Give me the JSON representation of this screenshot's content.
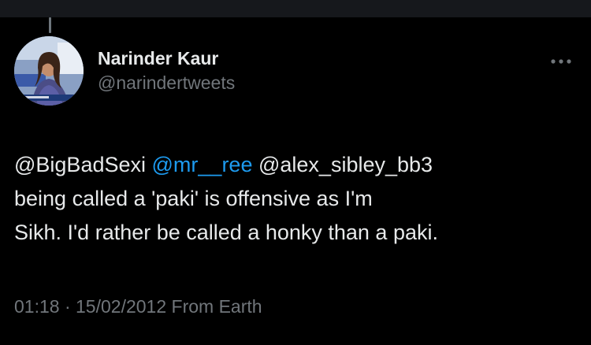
{
  "author": {
    "display_name": "Narinder Kaur",
    "handle": "@narindertweets"
  },
  "icons": {
    "more": "more-horizontal-icon",
    "avatar": "profile-photo"
  },
  "tweet": {
    "mentions": [
      "@BigBadSexi",
      "@mr__ree",
      "@alex_sibley_bb3"
    ],
    "line2": "being called a 'paki' is offensive as I'm",
    "line3": "Sikh. I'd rather be called a honky than a paki."
  },
  "meta": {
    "time": "01:18",
    "separator": "·",
    "date": "15/02/2012",
    "source": "From Earth"
  },
  "colors": {
    "background": "#000000",
    "text": "#e7e9ea",
    "secondary": "#71767b",
    "link": "#1d9bf0"
  }
}
